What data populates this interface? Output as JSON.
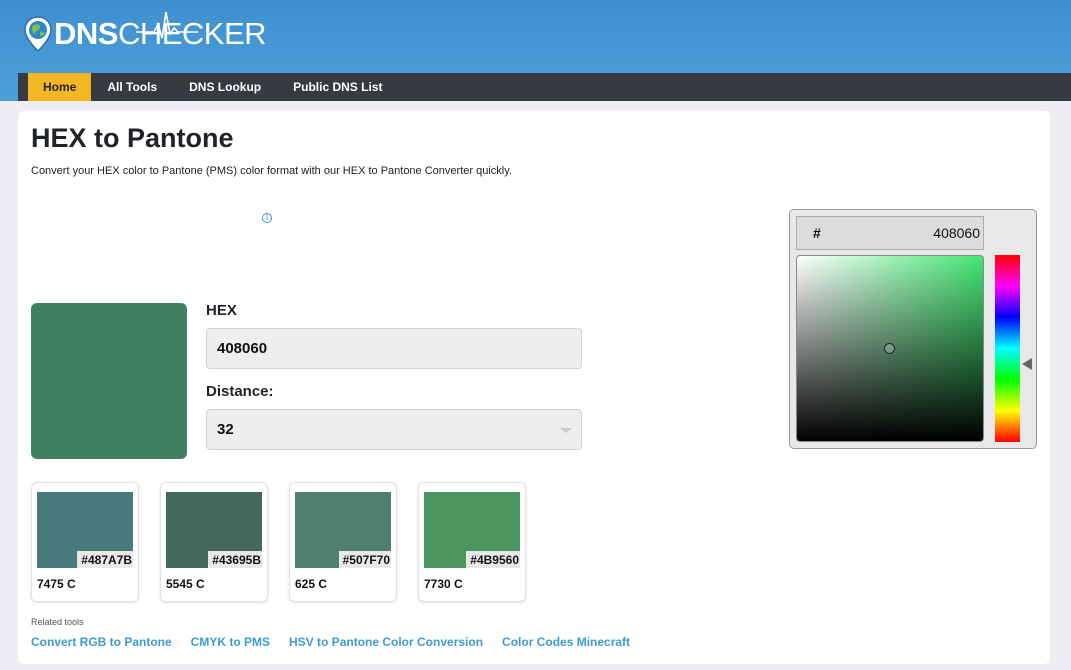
{
  "brand": {
    "logo_part1": "DNS",
    "logo_part2": "CHECKER"
  },
  "nav": {
    "items": [
      {
        "label": "Home",
        "active": true
      },
      {
        "label": "All Tools"
      },
      {
        "label": "DNS Lookup"
      },
      {
        "label": "Public DNS List"
      }
    ]
  },
  "page": {
    "title": "HEX to Pantone",
    "description": "Convert your HEX color to Pantone (PMS) color format with our HEX to Pantone Converter quickly.",
    "ad_icon": "info-icon"
  },
  "converter": {
    "preview_color": "#408060",
    "hex_label": "HEX",
    "hex_value": "408060",
    "distance_label": "Distance:",
    "distance_value": "32"
  },
  "picker": {
    "hash": "#",
    "hex_value": "408060",
    "saturation": 0.5,
    "value": 0.5,
    "hue_degrees": 150
  },
  "results": [
    {
      "hex": "#487A7B",
      "code": "7475 C",
      "color": "#487A7B"
    },
    {
      "hex": "#43695B",
      "code": "5545 C",
      "color": "#43695B"
    },
    {
      "hex": "#507F70",
      "code": "625 C",
      "color": "#507F70"
    },
    {
      "hex": "#4B9560",
      "code": "7730 C",
      "color": "#4B9560"
    }
  ],
  "related": {
    "label": "Related tools",
    "links": [
      "Convert RGB to Pantone",
      "CMYK to PMS",
      "HSV to Pantone Color Conversion",
      "Color Codes Minecraft"
    ]
  }
}
